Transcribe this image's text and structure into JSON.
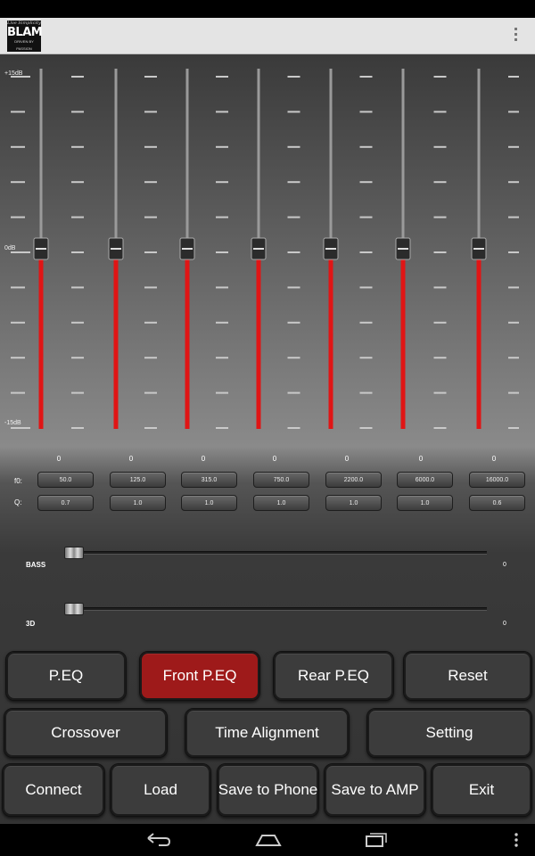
{
  "app": {
    "brand": "BLAM",
    "brand_tagline_top": "Live Simplicity",
    "brand_tagline_bottom": "DRIVEN BY PASSION"
  },
  "eq": {
    "db_labels": {
      "top": "+15dB",
      "mid": "0dB",
      "bottom": "-15dB"
    },
    "gain_range": [
      -15,
      15
    ],
    "bands": [
      {
        "gain": "0",
        "f0": "50.0",
        "q": "0.7"
      },
      {
        "gain": "0",
        "f0": "125.0",
        "q": "1.0"
      },
      {
        "gain": "0",
        "f0": "315.0",
        "q": "1.0"
      },
      {
        "gain": "0",
        "f0": "750.0",
        "q": "1.0"
      },
      {
        "gain": "0",
        "f0": "2200.0",
        "q": "1.0"
      },
      {
        "gain": "0",
        "f0": "6000.0",
        "q": "1.0"
      },
      {
        "gain": "0",
        "f0": "16000.0",
        "q": "0.6"
      }
    ],
    "f0_label": "f0:",
    "q_label": "Q:"
  },
  "sliders": {
    "bass": {
      "label": "BASS",
      "value": "0",
      "level": 0
    },
    "threed": {
      "label": "3D",
      "value": "0",
      "level": 0
    }
  },
  "buttons": {
    "row1": [
      "P.EQ",
      "Front P.EQ",
      "Rear P.EQ",
      "Reset"
    ],
    "row2": [
      "Crossover",
      "Time Alignment",
      "Setting"
    ],
    "row3": [
      "Connect",
      "Load",
      "Save to Phone",
      "Save to AMP",
      "Exit"
    ],
    "active": "Front P.EQ"
  },
  "colors": {
    "accent_red": "#e01515",
    "active_button": "#9e1a1a",
    "action_bar": "#e4e4e4"
  },
  "icons": {
    "overflow": "overflow-menu-icon",
    "nav_back": "back-icon",
    "nav_home": "home-icon",
    "nav_recents": "recents-icon",
    "nav_menu": "menu-icon"
  }
}
